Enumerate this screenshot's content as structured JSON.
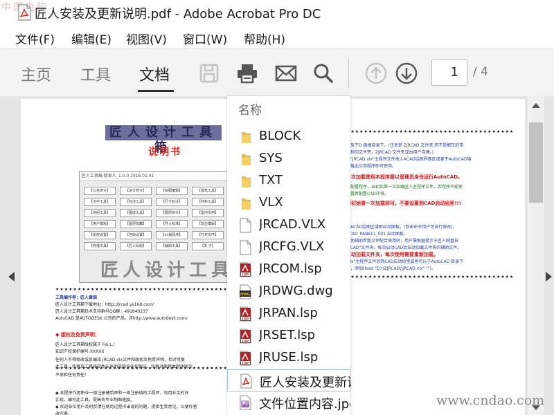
{
  "window": {
    "title": "匠人安装及更新说明.pdf - Adobe Acrobat Pro DC",
    "watermark": "中国电脑"
  },
  "menubar": {
    "items": [
      "文件(F)",
      "编辑(E)",
      "视图(V)",
      "窗口(W)",
      "帮助(H)"
    ]
  },
  "toolbar": {
    "tabs": [
      "主页",
      "工具",
      "文档"
    ],
    "active_tab": "文档",
    "page_current": "1",
    "page_total": "/ 4",
    "tools": [
      "save-icon",
      "print-icon",
      "email-icon",
      "search-icon",
      "page-up-icon",
      "page-down-icon"
    ]
  },
  "file_popup": {
    "header": "名称",
    "items": [
      {
        "name": "BLOCK",
        "icon": "folder-icon"
      },
      {
        "name": "SYS",
        "icon": "folder-icon"
      },
      {
        "name": "TXT",
        "icon": "folder-icon"
      },
      {
        "name": "VLX",
        "icon": "folder-icon"
      },
      {
        "name": "JRCAD.VLX",
        "icon": "file-icon"
      },
      {
        "name": "JRCFG.VLX",
        "icon": "file-icon"
      },
      {
        "name": "JRCOM.lsp",
        "icon": "lsp-file-icon"
      },
      {
        "name": "JRDWG.dwg",
        "icon": "dwg-file-icon"
      },
      {
        "name": "JRPAN.lsp",
        "icon": "lsp-file-icon"
      },
      {
        "name": "JRSET.lsp",
        "icon": "lsp-file-icon"
      },
      {
        "name": "JRUSE.lsp",
        "icon": "lsp-file-icon"
      },
      {
        "name": "匠人安装及更新说明.pdf",
        "icon": "pdf-file-icon",
        "selected": true
      },
      {
        "name": "文件位置内容.jpg",
        "icon": "image-file-icon"
      }
    ]
  },
  "document": {
    "banner": "匠人设计工具箱",
    "subtitle": "说明书",
    "screenshot_title": "匠人工具箱 版本人_1.0.0 2018.01.01",
    "screenshot_buttons": [
      "【公共命令】",
      "【设计命令】",
      "【绘图编辑】",
      "【建筑工具】",
      "【文字工具】",
      "【标注工具】",
      "【尺寸标注】",
      "【材料工具】",
      "【块组工具】",
      "【图库工具】",
      "【图层命令】",
      "【室内专用】",
      "【用户模板】",
      "【图层隐藏】",
      "【导入标准】",
      "【双击模版】",
      "【系统设置】",
      "【自由设置】",
      "【ini版程序】",
      "【打开文件】",
      "【管理工具】",
      "【匠人码题】",
      "【辅助工具】",
      "【关 于】"
    ],
    "screenshot_big_text": "匠人设计工具箱",
    "left_lines": [
      {
        "text": "工具编作者：匠人黄国",
        "style": "blue bold"
      },
      {
        "text": "匠人设计工具箱下载地址：http://jrcad.ys168.com/",
        "style": ""
      },
      {
        "text": "匠人设计工具箱技术支持群号QQ群：491840237",
        "style": ""
      },
      {
        "text": "AutoCAD 是AUTODESK 公司的产品，详http://www.autodesk.com/",
        "style": ""
      },
      {
        "text": "◆ 版权及免责声明：",
        "style": "red"
      },
      {
        "text": "匠人设计工具箱版权属于 Fei.L.!",
        "style": ""
      },
      {
        "text": "知识产权保护编号 XXXXX",
        "style": ""
      },
      {
        "text": "任何人不得修改或反编译 JRCAD.vlx文件和版权及免责声明。但对可复",
        "style": ""
      },
      {
        "text": "此工具，作者及工具箱软件未声明或隐含任何保证，作者对使用本程序所引",
        "style": ""
      },
      {
        "text": "不承担任何责任！",
        "style": ""
      },
      {
        "text": "◆ 本程序作者职业一级注册建筑师和一级注册结构工程师，利用业余时间",
        "style": ""
      },
      {
        "text": "实现，编写此工具，提高各专业制图速度。",
        "style": ""
      },
      {
        "text": "◆ 欢迎各位用户及时反馈在使用过程中出现的问题，提供宝贵意见，以便作者",
        "style": ""
      },
      {
        "text": "改完善。",
        "style": ""
      }
    ],
    "right_lines": [
      {
        "text": "将放于D 盘根目录下。(注意是 ZJRCAD 文件夹,而不是解压的带",
        "style": "blue"
      },
      {
        "text": "名称的文件夹，ZJRCAD 文件夹或由用户自建。)",
        "style": "blue"
      },
      {
        "text": "将\"JRCAD.vlx\"主程序文件拖入ACAD绘图界面区或者于AutoCAD输",
        "style": "blue"
      },
      {
        "text": "加载此应用程序即可使用。",
        "style": "blue"
      },
      {
        "text": "一次加载使用本程序要以管理员身份运行AutoCAD。",
        "style": "red"
      },
      {
        "text": "为配置程序，当初始第一次加载匠人主程序文件，若程序不能使",
        "style": "green"
      },
      {
        "text": "开置新配置CAD环境。",
        "style": "green"
      },
      {
        "text": "需初始第一次加载即可，不要设置到CAD启动组里!!!",
        "style": "red"
      },
      {
        "text": "击ACAD绘图区域即启动面板。(双击命令用户可自行修改)。",
        "style": "blue"
      },
      {
        "text": "RCAD_PANEL1_001 启动面板。",
        "style": "blue"
      },
      {
        "text": "其他辅助参数文件配合使用时，用户需根据提示于匠人网盘自",
        "style": "blue"
      },
      {
        "text": "JRCAD\"文件夹，每次启动CAD会自动加载文件夹的辅助文件。",
        "style": "blue"
      },
      {
        "text": "自动加载文件夹，每次使用需要重新加载。",
        "style": "red"
      },
      {
        "text": ".vlx\"主程序文件放到CAD启动组里或者可以于AutoCAD 目录下",
        "style": "blue"
      },
      {
        "text": "中，添加(load \"D:\\\\ZJRCAD\\\\JRCAD.vlx\" \"\")。",
        "style": "blue"
      }
    ],
    "stars": "★★★★★★★★★★★★★★★★★★★★★★★★★★★★★★★★★★★★★★★★★★★★★★★★★★"
  },
  "watermark_br": {
    "prefix": "www.",
    "brand": "cndao",
    "suffix": ".com"
  }
}
